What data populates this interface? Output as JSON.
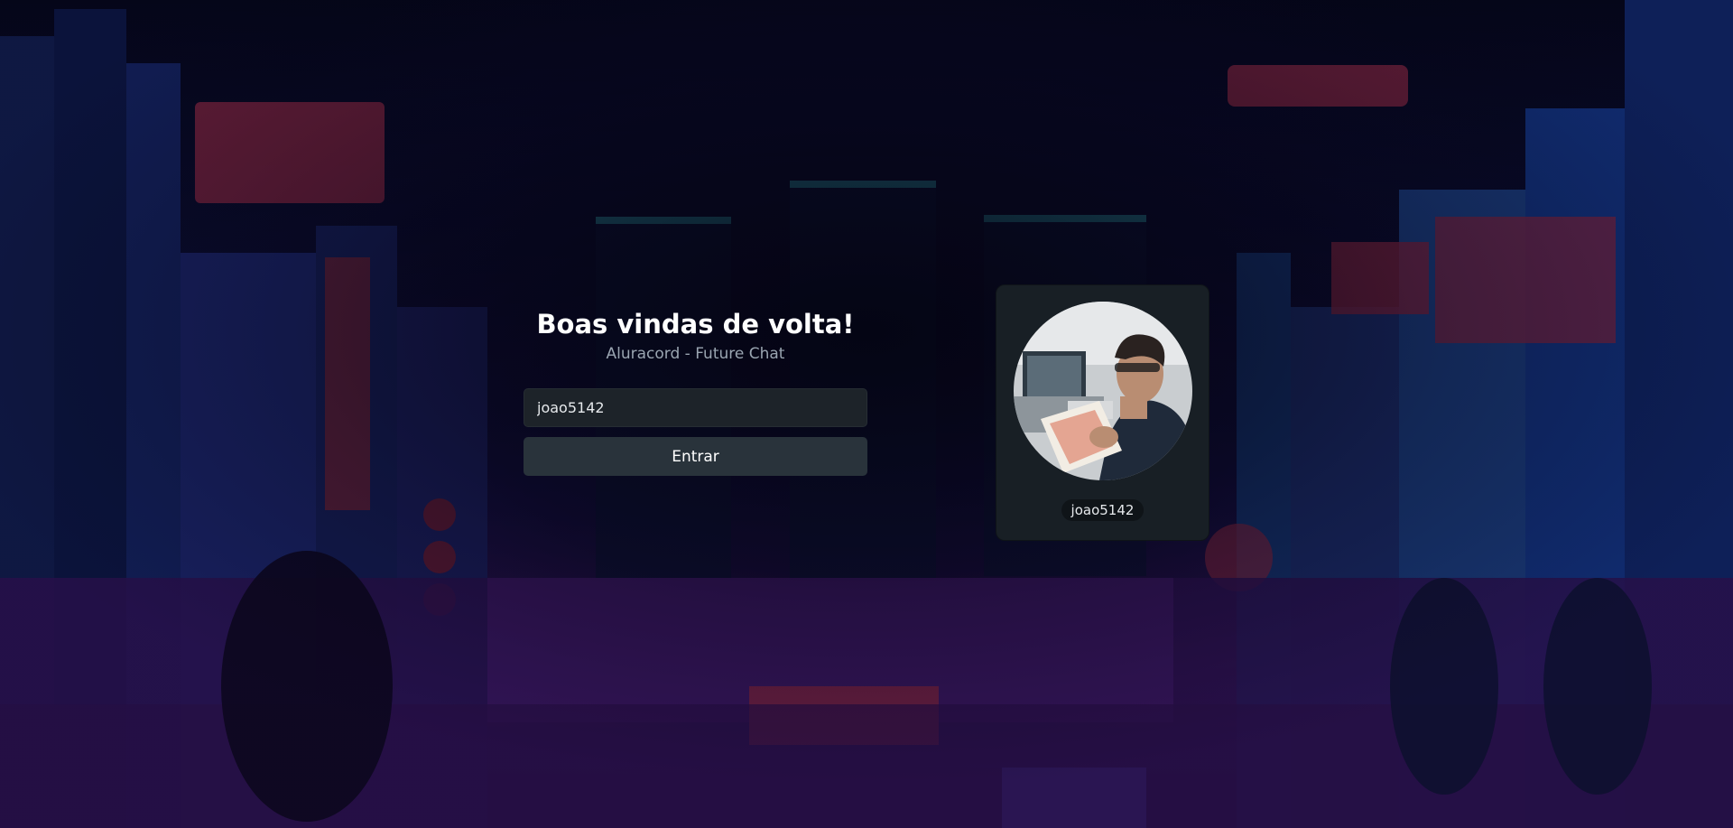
{
  "login": {
    "title": "Boas vindas de volta!",
    "subtitle": "Aluracord - Future Chat",
    "username_value": "joao5142",
    "submit_label": "Entrar"
  },
  "profile": {
    "username": "joao5142"
  },
  "colors": {
    "card_background": "#181f25",
    "input_background": "#1d2329",
    "button_background": "#29333b",
    "subtitle_text": "#9aa5b1"
  },
  "icons": [
    "user-avatar-photo",
    "pixel-city-background"
  ]
}
